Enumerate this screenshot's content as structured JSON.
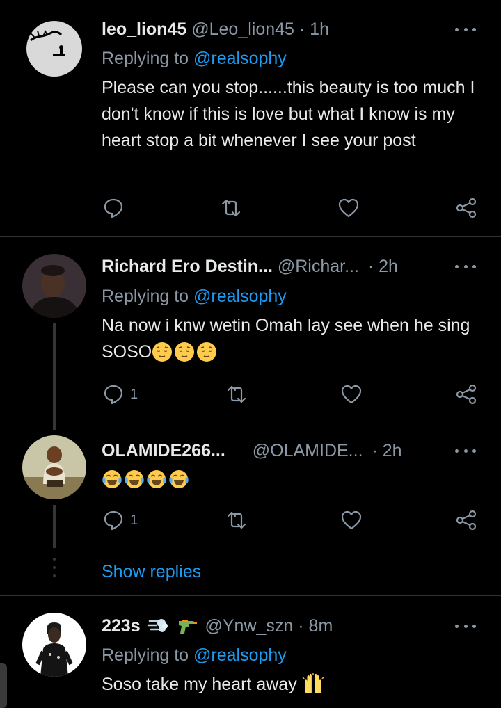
{
  "tweets": [
    {
      "name": "leo_lion45",
      "handle": "@Leo_lion45",
      "time": "· 1h",
      "replying_prefix": "Replying to ",
      "replying_to": "@realsophy",
      "text": "Please can you stop......this beauty is too much I don't know if this is love but what I know is my heart stop a bit whenever I see your post",
      "reply_count": "",
      "avatar_icon": "moon-silhouette-avatar"
    },
    {
      "name": "Richard Ero Destin...",
      "handle": "@Richar...",
      "time": "· 2h",
      "replying_prefix": "Replying to ",
      "replying_to": "@realsophy",
      "text": "Na now i knw wetin Omah lay see when he sing SOSO",
      "reply_count": "1",
      "emoji": "relieved-face"
    },
    {
      "name": "OLAMIDE266...",
      "handle": "@OLAMIDE...",
      "time": "· 2h",
      "text": "",
      "reply_count": "1",
      "emoji": "tears-of-joy-face"
    },
    {
      "name": "223s",
      "handle": "@Ynw_szn",
      "time": "· 8m",
      "replying_prefix": "Replying to ",
      "replying_to": "@realsophy",
      "text": "Soso take my heart away",
      "emoji": "raised-hands"
    }
  ],
  "show_replies": "Show replies",
  "colors": {
    "link": "#1d9bf0",
    "muted": "#8b98a5",
    "text": "#e7e9ea",
    "background": "#000000"
  }
}
